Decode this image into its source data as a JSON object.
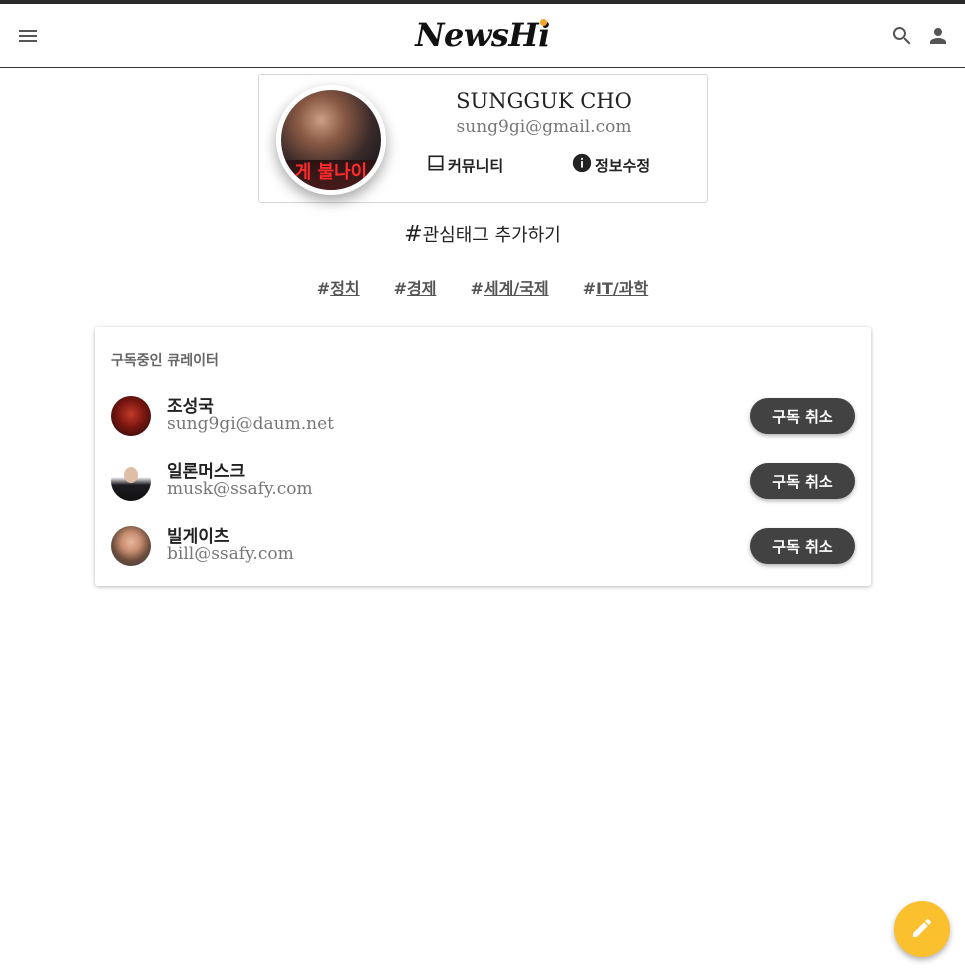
{
  "header": {
    "logo_main": "NewsH",
    "logo_end": "i",
    "accent_color": "#f5a623"
  },
  "profile": {
    "name": "SUNGGUK CHO",
    "email": "sung9gi@gmail.com",
    "avatar_text": "게 불나이",
    "community_label": "커뮤니티",
    "edit_info_label": "정보수정"
  },
  "interest": {
    "add_tag_symbol": "#",
    "add_tag_label": "관심태그 추가하기",
    "tags": [
      {
        "hash": "#",
        "label": "정치"
      },
      {
        "hash": "#",
        "label": "경제"
      },
      {
        "hash": "#",
        "label": "세계/국제"
      },
      {
        "hash": "#",
        "label": "IT/과학"
      }
    ]
  },
  "curators": {
    "title": "구독중인 큐레이터",
    "items": [
      {
        "name": "조성국",
        "email": "sung9gi@daum.net",
        "button": "구독 취소"
      },
      {
        "name": "일론머스크",
        "email": "musk@ssafy.com",
        "button": "구독 취소"
      },
      {
        "name": "빌게이츠",
        "email": "bill@ssafy.com",
        "button": "구독 취소"
      }
    ]
  },
  "icons": [
    "menu-icon",
    "search-icon",
    "account-icon",
    "community-icon",
    "info-icon",
    "pencil-icon"
  ],
  "colors": {
    "fab": "#fbc02d",
    "button_dark": "#424242"
  }
}
